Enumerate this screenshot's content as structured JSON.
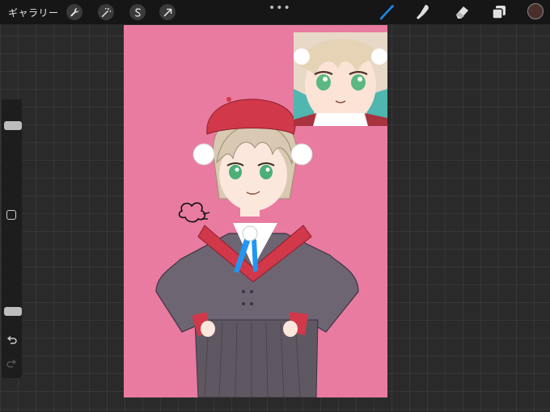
{
  "topbar": {
    "gallery_label": "ギャラリー",
    "left_tools": [
      {
        "name": "actions",
        "icon": "wrench-icon"
      },
      {
        "name": "adjustments",
        "icon": "magic-wand-icon"
      },
      {
        "name": "selection",
        "icon": "selection-s-icon"
      },
      {
        "name": "transform",
        "icon": "arrow-cursor-icon"
      }
    ],
    "menu_dots": "•••",
    "right_tools": [
      {
        "name": "brush",
        "icon": "brush-icon",
        "active": true
      },
      {
        "name": "smudge",
        "icon": "smudge-finger-icon",
        "active": false
      },
      {
        "name": "eraser",
        "icon": "eraser-icon",
        "active": false
      },
      {
        "name": "layers",
        "icon": "layers-icon",
        "active": false
      }
    ],
    "current_color": "#4a2f2a",
    "active_color": "#1e88e5"
  },
  "sidebar": {
    "brush_size_level": 0.76,
    "opacity_level": 0.1,
    "icons": [
      "square-modify-icon",
      "undo-icon",
      "redo-icon"
    ]
  },
  "canvas": {
    "background": "#e97ba0"
  },
  "reference": {
    "icon": "reference-image"
  }
}
